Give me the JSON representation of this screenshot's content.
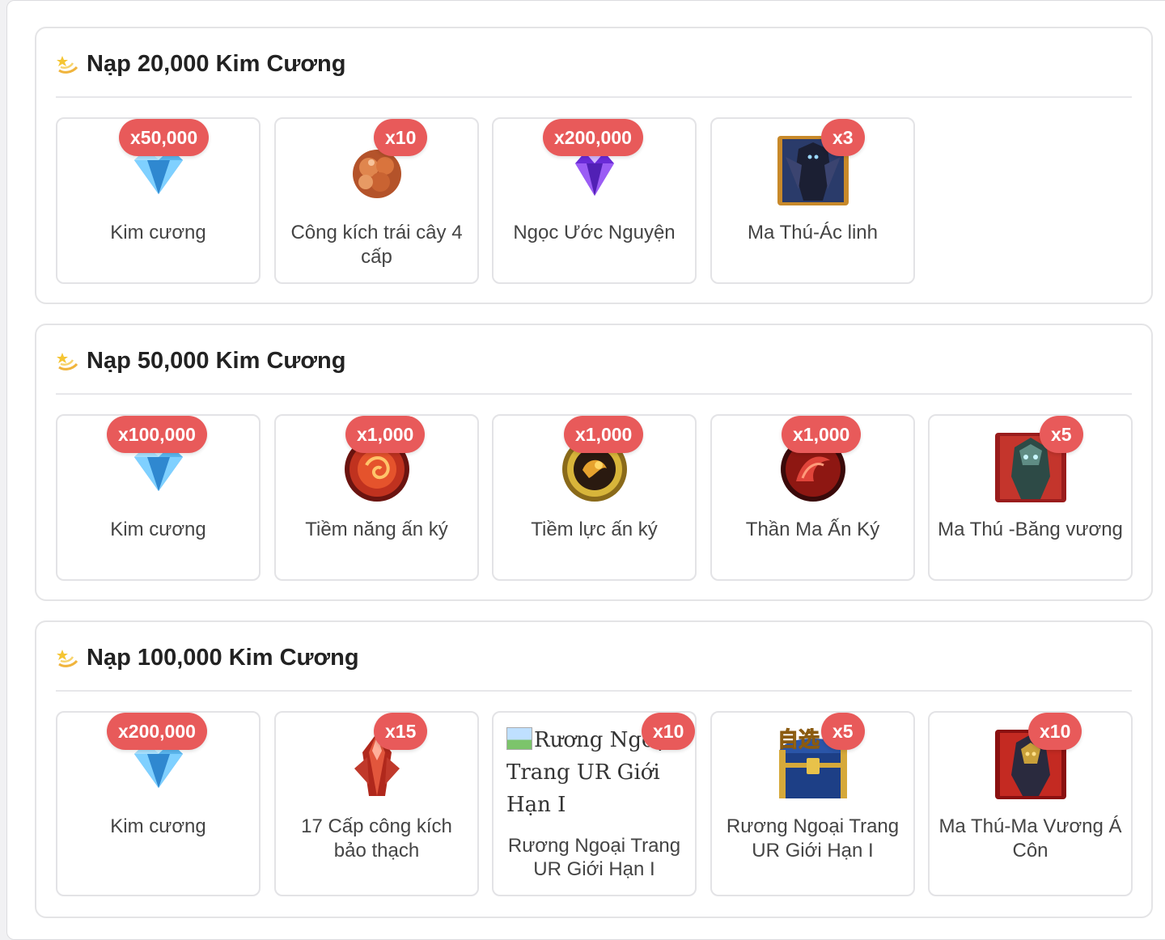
{
  "colors": {
    "badge": "#e85a5a",
    "card_border": "#e4e4e6",
    "title": "#222222"
  },
  "sections": [
    {
      "title": "Nạp 20,000 Kim Cương",
      "icon": "dizzy-star-icon",
      "items": [
        {
          "name": "Kim cương",
          "qty": "x50,000",
          "icon": "blue-diamond-icon"
        },
        {
          "name": "Công kích trái cây 4 cấp",
          "qty": "x10",
          "icon": "orange-fruit-icon"
        },
        {
          "name": "Ngọc Ước Nguyện",
          "qty": "x200,000",
          "icon": "purple-gem-icon"
        },
        {
          "name": "Ma Thú-Ác linh",
          "qty": "x3",
          "icon": "dark-beast-card-icon"
        }
      ]
    },
    {
      "title": "Nạp 50,000 Kim Cương",
      "icon": "dizzy-star-icon",
      "items": [
        {
          "name": "Kim cương",
          "qty": "x100,000",
          "icon": "blue-diamond-icon"
        },
        {
          "name": "Tiềm năng ấn ký",
          "qty": "x1,000",
          "icon": "red-dragon-seal-icon"
        },
        {
          "name": "Tiềm lực ấn ký",
          "qty": "x1,000",
          "icon": "gold-seal-icon"
        },
        {
          "name": "Thần Ma Ấn Ký",
          "qty": "x1,000",
          "icon": "crimson-seal-icon"
        },
        {
          "name": "Ma Thú -Băng vương",
          "qty": "x5",
          "icon": "ice-king-beast-card-icon"
        }
      ]
    },
    {
      "title": "Nạp 100,000 Kim Cương",
      "icon": "dizzy-star-icon",
      "items": [
        {
          "name": "Kim cương",
          "qty": "x200,000",
          "icon": "blue-diamond-icon"
        },
        {
          "name": "17 Cấp công kích bảo thạch",
          "qty": "x15",
          "icon": "red-crystal-icon"
        },
        {
          "name": "Rương Ngoại Trang UR Giới Hạn I",
          "qty": "x10",
          "icon": "broken-image-icon",
          "alt": "Rương Ngoại Trang UR Giới Hạn I"
        },
        {
          "name": "Rương Ngoại Trang UR Giới Hạn I",
          "qty": "x5",
          "icon": "treasure-chest-icon",
          "chest_label": "自选"
        },
        {
          "name": "Ma Thú-Ma Vương Á Côn",
          "qty": "x10",
          "icon": "demon-king-beast-card-icon"
        }
      ]
    }
  ]
}
